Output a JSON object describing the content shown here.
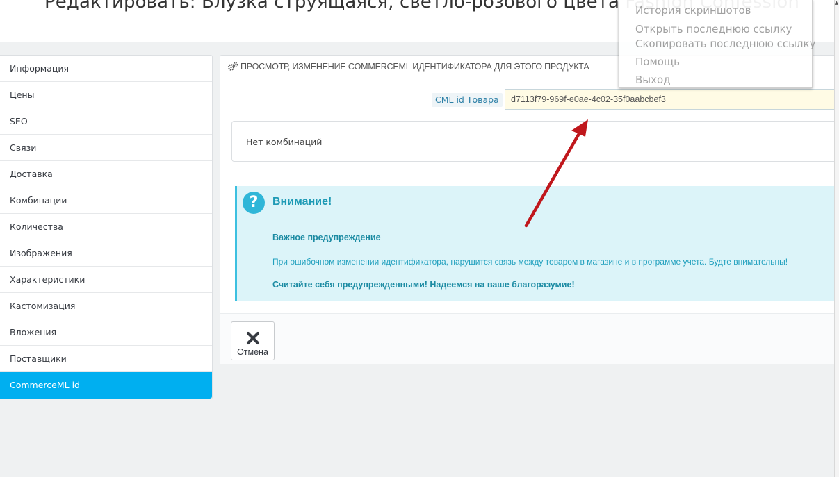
{
  "page": {
    "title": "Редактировать: Блузка струящаяся, светло-розового цвета Fashion Confession"
  },
  "sidebar": {
    "items": [
      {
        "label": "Информация"
      },
      {
        "label": "Цены"
      },
      {
        "label": "SEO"
      },
      {
        "label": "Связи"
      },
      {
        "label": "Доставка"
      },
      {
        "label": "Комбинации"
      },
      {
        "label": "Количества"
      },
      {
        "label": "Изображения"
      },
      {
        "label": "Характеристики"
      },
      {
        "label": "Кастомизация"
      },
      {
        "label": "Вложения"
      },
      {
        "label": "Поставщики"
      },
      {
        "label": "CommerceML id"
      }
    ],
    "active_item": "CommerceML id"
  },
  "panel": {
    "heading": "ПРОСМОТР, ИЗМЕНЕНИЕ COMMERCEML ИДЕНТИФИКАТОРА ДЛЯ ЭТОГО ПРОДУКТА",
    "heading_icon": "cogs-icon",
    "cml_field": {
      "label": "CML id Товара",
      "value": "d7113f79-969f-e0ae-4c02-35f0aabcbef3"
    },
    "combinations_text": "Нет комбинаций",
    "alert": {
      "icon": "question-icon",
      "title": "Внимание!",
      "subtitle": "Важное предупреждение",
      "text": "При ошибочном изменении идентификатора, нарушится связь между товаром в магазине и в программе учета. Будте внимательны!",
      "closing": "Считайте себя предупрежденными! Надеемся на ваше благоразумие!"
    },
    "footer": {
      "cancel_label": "Отмена",
      "cancel_icon": "close-icon"
    }
  },
  "context_menu": {
    "items": [
      {
        "label": "История скриншотов"
      },
      {
        "label": "Открыть последнюю ссылку"
      },
      {
        "label": "Скопировать последнюю ссылку"
      },
      {
        "label": "Помощь"
      },
      {
        "label": "Выход"
      }
    ]
  },
  "colors": {
    "accent": "#00aff0",
    "alert_bg": "#dcf4f9",
    "alert_text": "#1e9ab5",
    "arrow": "#c0171c"
  }
}
